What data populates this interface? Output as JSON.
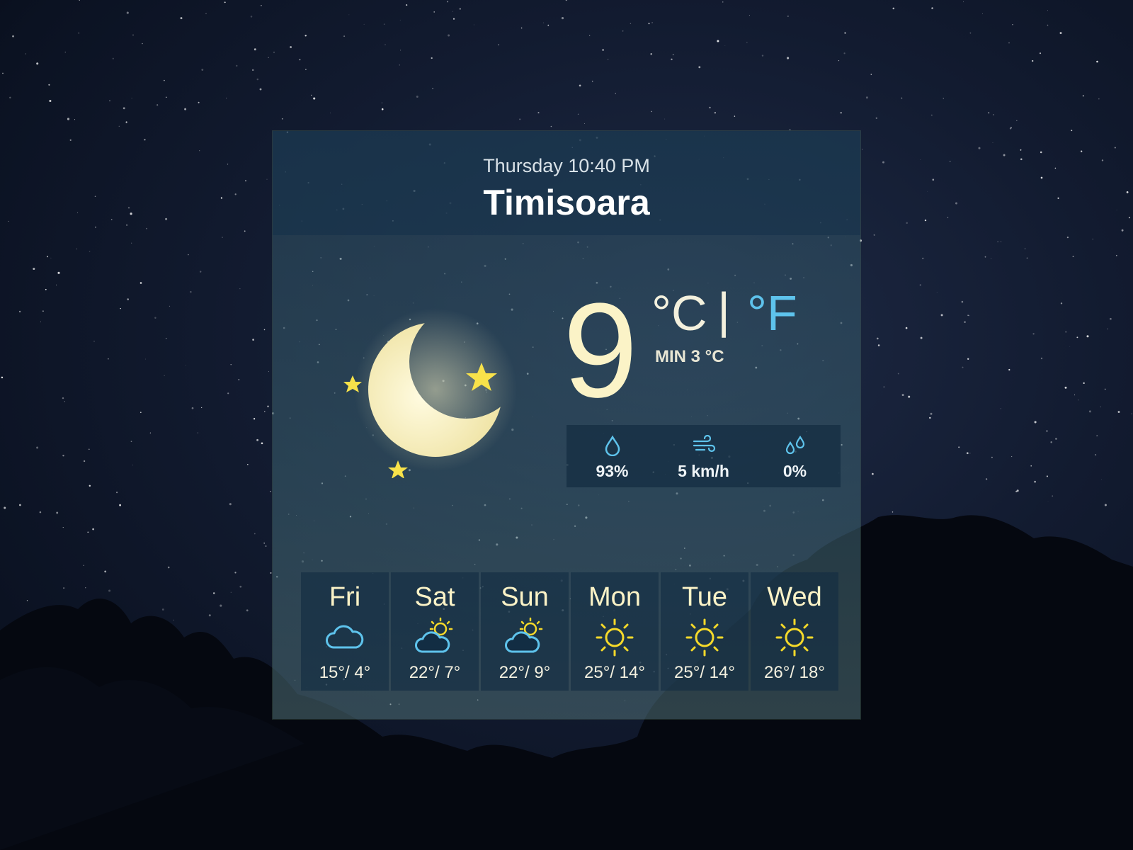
{
  "header": {
    "datetime": "Thursday 10:40 PM",
    "city": "Timisoara"
  },
  "current": {
    "temperature": "9",
    "unit_c": "°C",
    "separator": "|",
    "unit_f": "°F",
    "min_label": "MIN 3 °C",
    "condition_icon": "crescent-moon-with-stars"
  },
  "stats": [
    {
      "icon": "humidity-drop-icon",
      "value": "93%"
    },
    {
      "icon": "wind-icon",
      "value": "5 km/h"
    },
    {
      "icon": "precipitation-drops-icon",
      "value": "0%"
    }
  ],
  "forecast": [
    {
      "day": "Fri",
      "icon": "cloud",
      "temps": "15°/ 4°"
    },
    {
      "day": "Sat",
      "icon": "partly-sunny",
      "temps": "22°/ 7°"
    },
    {
      "day": "Sun",
      "icon": "partly-sunny",
      "temps": "22°/ 9°"
    },
    {
      "day": "Mon",
      "icon": "sun",
      "temps": "25°/ 14°"
    },
    {
      "day": "Tue",
      "icon": "sun",
      "temps": "25°/ 14°"
    },
    {
      "day": "Wed",
      "icon": "sun",
      "temps": "26°/ 18°"
    }
  ],
  "colors": {
    "accent_blue": "#5ec3ec",
    "sun_yellow": "#f5d92a",
    "moon_cream": "#fbf3c7"
  }
}
